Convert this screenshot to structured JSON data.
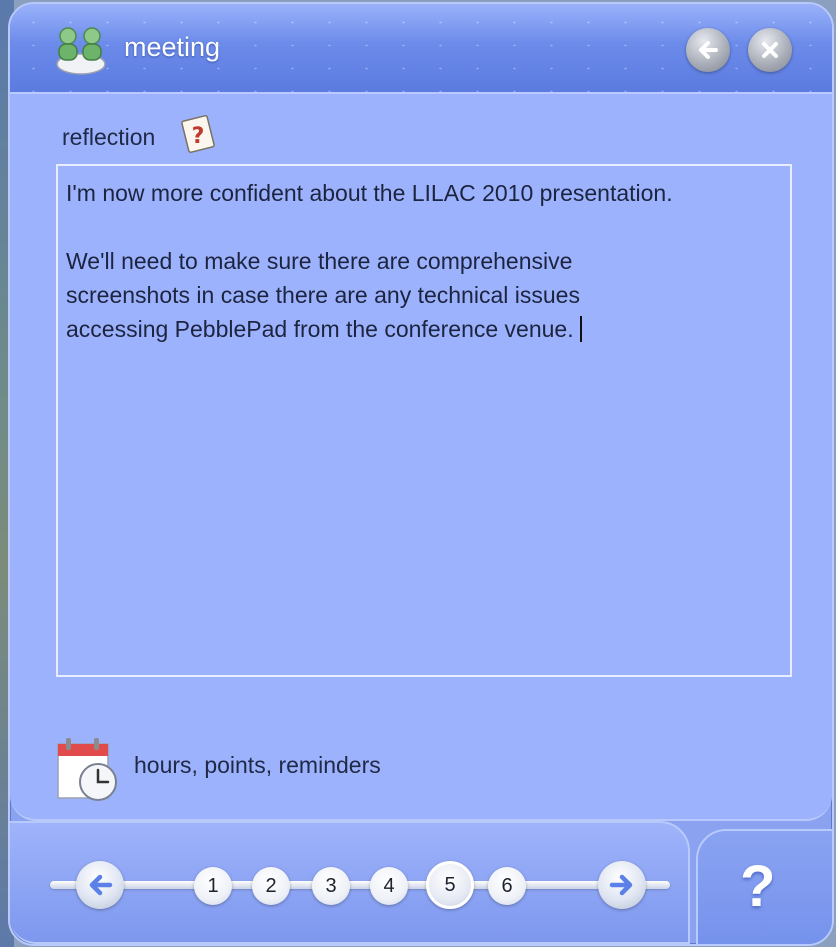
{
  "window": {
    "title": "meeting",
    "app_icon": "people-icon",
    "back_icon": "back-arrow-icon",
    "close_icon": "close-icon"
  },
  "reflection": {
    "label": "reflection",
    "help_icon": "help-document-icon",
    "text": "I'm now more confident about the LILAC 2010 presentation.\n\nWe'll need to make sure there are comprehensive\nscreenshots in case there are any technical issues\naccessing PebblePad from the conference venue."
  },
  "options": {
    "icon": "calendar-clock-icon",
    "label": "hours, points, reminders"
  },
  "pager": {
    "pages": [
      "1",
      "2",
      "3",
      "4",
      "5",
      "6"
    ],
    "current_page": "5",
    "prev_icon": "prev-arrow-icon",
    "next_icon": "next-arrow-icon"
  },
  "help": {
    "label": "?"
  },
  "colors": {
    "window_bg": "#9db2fc",
    "title_bar": "#6c8bea",
    "accent_arrow": "#5b80e8"
  }
}
